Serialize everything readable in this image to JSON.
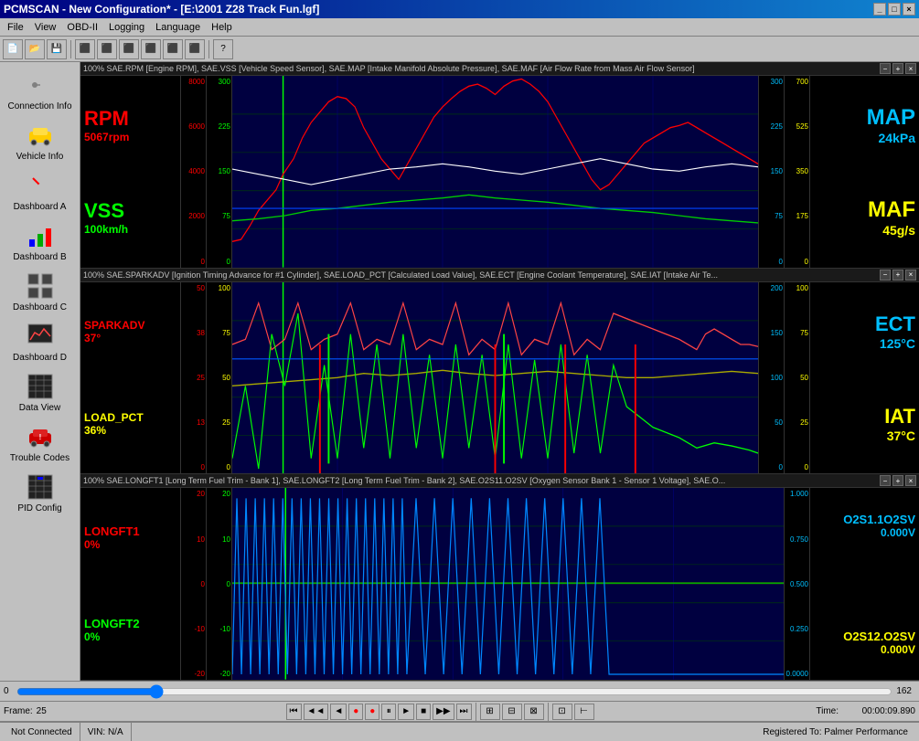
{
  "window": {
    "title": "PCMSCAN - New Configuration* - [E:\\2001 Z28 Track Fun.lgf]",
    "minimize": "_",
    "maximize": "□",
    "close": "×"
  },
  "menu": {
    "items": [
      "File",
      "View",
      "OBD-II",
      "Logging",
      "Language",
      "Help"
    ]
  },
  "sidebar": {
    "items": [
      {
        "id": "connection-info",
        "label": "Connection Info",
        "icon": "plug"
      },
      {
        "id": "vehicle-info",
        "label": "Vehicle Info",
        "icon": "car"
      },
      {
        "id": "dashboard-a",
        "label": "Dashboard A",
        "icon": "gauge"
      },
      {
        "id": "dashboard-b",
        "label": "Dashboard B",
        "icon": "bar-chart"
      },
      {
        "id": "dashboard-c",
        "label": "Dashboard C",
        "icon": "grid"
      },
      {
        "id": "dashboard-d",
        "label": "Dashboard D",
        "icon": "chart"
      },
      {
        "id": "data-view",
        "label": "Data View",
        "icon": "table"
      },
      {
        "id": "trouble-codes",
        "label": "Trouble Codes",
        "icon": "car-warning"
      },
      {
        "id": "pid-config",
        "label": "PID Config",
        "icon": "settings"
      }
    ]
  },
  "charts": {
    "panel1": {
      "header": "100% SAE.RPM [Engine RPM], SAE.VSS [Vehicle Speed Sensor], SAE.MAP [Intake Manifold Absolute Pressure], SAE.MAF [Air Flow Rate from Mass Air Flow Sensor]",
      "params_left": [
        {
          "name": "RPM",
          "value": "5067rpm",
          "color": "#ff0000"
        },
        {
          "name": "VSS",
          "value": "100km/h",
          "color": "#00ff00"
        }
      ],
      "params_right": [
        {
          "name": "MAP",
          "color": "#00bfff",
          "value": "24kPa"
        },
        {
          "name": "MAF",
          "color": "#ffff00",
          "value": "45g/s"
        }
      ],
      "scales_left": [
        "8000",
        "6000",
        "4000",
        "2000",
        "0"
      ],
      "scales_left2": [
        "300",
        "225",
        "150",
        "75",
        "0"
      ],
      "scales_right": [
        "300",
        "225",
        "150",
        "75",
        "0"
      ],
      "scales_right2": [
        "700",
        "525",
        "350",
        "175",
        "0"
      ]
    },
    "panel2": {
      "header": "100% SAE.SPARKADV [Ignition Timing Advance for #1 Cylinder], SAE.LOAD_PCT [Calculated Load Value], SAE.ECT [Engine Coolant Temperature], SAE.IAT [Intake Air Te...",
      "params_left": [
        {
          "name": "SPARKADV",
          "value": "37°",
          "color": "#ff0000"
        },
        {
          "name": "LOAD_PCT",
          "value": "36%",
          "color": "#ffff00"
        }
      ],
      "params_right": [
        {
          "name": "ECT",
          "color": "#00bfff",
          "value": "125°C"
        },
        {
          "name": "IAT",
          "color": "#ffff00",
          "value": "37°C"
        }
      ],
      "scales_left": [
        "50",
        "38",
        "25",
        "13",
        "0"
      ],
      "scales_left2": [
        "100",
        "75",
        "50",
        "25",
        "0"
      ],
      "scales_right": [
        "200",
        "150",
        "100",
        "50",
        "0"
      ],
      "scales_right2": [
        "100",
        "75",
        "50",
        "25",
        "0"
      ]
    },
    "panel3": {
      "header": "100% SAE.LONGFT1 [Long Term Fuel Trim - Bank 1], SAE.LONGFT2 [Long Term Fuel Trim - Bank 2], SAE.O2S11.O2SV [Oxygen Sensor Bank 1 - Sensor 1 Voltage], SAE.O...",
      "params_left": [
        {
          "name": "LONGFT1",
          "value": "0%",
          "color": "#ff0000"
        },
        {
          "name": "LONGFT2",
          "value": "0%",
          "color": "#00ff00"
        }
      ],
      "params_right": [
        {
          "name": "O2S1.1O2SV",
          "color": "#00bfff",
          "value": "0.000V"
        },
        {
          "name": "O2S12.O2SV",
          "color": "#ffff00",
          "value": "0.000V"
        }
      ],
      "scales_left": [
        "20",
        "10",
        "0",
        "-10",
        "-20"
      ],
      "scales_left2": [
        "20",
        "10",
        "0",
        "-10",
        "-20"
      ],
      "scales_right": [
        "1.000",
        "0.750",
        "0.500",
        "0.250",
        "0.0000"
      ],
      "scales_right2": []
    }
  },
  "playback": {
    "frame_label": "Frame:",
    "frame_value": "25",
    "time_label": "Time:",
    "time_value": "00:00:09.890",
    "slider_min": "0",
    "slider_max": "162",
    "slider_value": "25",
    "buttons": [
      "⏮",
      "◀◀",
      "◀",
      "●",
      "●",
      "⏸",
      "▶",
      "⏹",
      "▶▶",
      "⏭"
    ]
  },
  "statusbar": {
    "connection": "Not Connected",
    "vin": "VIN: N/A",
    "registration": "Registered To: Palmer Performance"
  },
  "transport_buttons": [
    {
      "id": "first",
      "icon": "⏮",
      "label": "First"
    },
    {
      "id": "prev-fast",
      "icon": "◄◄",
      "label": "Previous Fast"
    },
    {
      "id": "prev",
      "icon": "◄",
      "label": "Previous"
    },
    {
      "id": "rec1",
      "icon": "●",
      "label": "Record1"
    },
    {
      "id": "rec2",
      "icon": "●",
      "label": "Record2"
    },
    {
      "id": "pause",
      "icon": "⏸",
      "label": "Pause"
    },
    {
      "id": "play",
      "icon": "►",
      "label": "Play"
    },
    {
      "id": "stop",
      "icon": "■",
      "label": "Stop"
    },
    {
      "id": "next-fast",
      "icon": "►►",
      "label": "Next Fast"
    },
    {
      "id": "last",
      "icon": "⏭",
      "label": "Last"
    }
  ]
}
